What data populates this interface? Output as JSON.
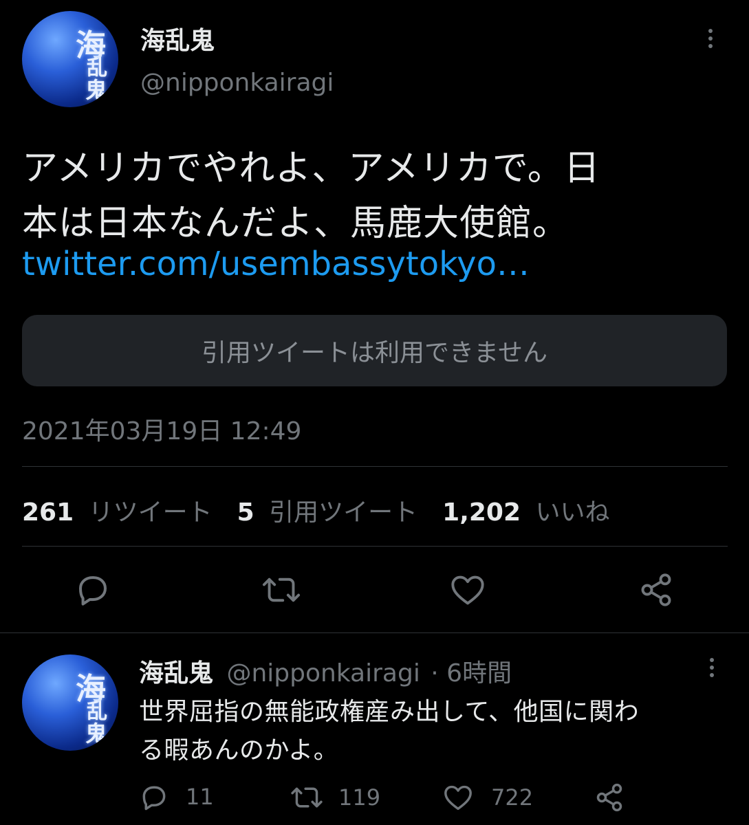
{
  "main_tweet": {
    "author_name": "海乱鬼",
    "author_handle": "@nipponkairagi",
    "text_line1": "アメリカでやれよ、アメリカで。日",
    "text_line2": "本は日本なんだよ、馬鹿大使館。",
    "link": "twitter.com/usembassytokyo…",
    "quote_unavailable": "引用ツイートは利用できません",
    "timestamp": "2021年03月19日 12:49",
    "stats": {
      "retweets_count": "261",
      "retweets_label": "リツイート",
      "quotes_count": "5",
      "quotes_label": "引用ツイート",
      "likes_count": "1,202",
      "likes_label": "いいね"
    }
  },
  "reply": {
    "author_name": "海乱鬼",
    "author_handle": "@nipponkairagi",
    "time_ago": "· 6時間",
    "text_line1": "世界屈指の無能政権産み出して、他国に関わ",
    "text_line2": "る暇あんのかよ。",
    "reply_count": "11",
    "retweet_count": "119",
    "like_count": "722"
  },
  "avatar_glyphs": {
    "a": "海",
    "b": "乱",
    "c": "鬼"
  },
  "icons": {
    "reply": "reply-icon",
    "retweet": "retweet-icon",
    "like": "heart-icon",
    "share": "share-icon",
    "more": "more-icon"
  },
  "colors": {
    "background": "#000000",
    "text": "#e7e9ea",
    "muted": "#71767b",
    "link": "#1d9bf0",
    "quote_bg": "#202327",
    "divider": "#2f3336"
  }
}
